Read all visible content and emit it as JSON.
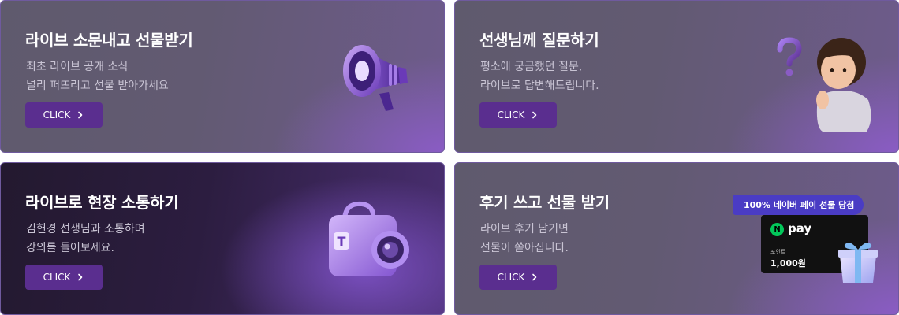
{
  "cards": [
    {
      "title": "라이브 소문내고 선물받기",
      "desc_line1": "최초 라이브 공개 소식",
      "desc_line2": "널리 퍼뜨리고 선물 받아가세요",
      "button_label": "CLICK",
      "illustration": "megaphone-icon"
    },
    {
      "title": "선생님께 질문하기",
      "desc_line1": "평소에 궁금했던 질문,",
      "desc_line2": "라이브로 답변해드립니다.",
      "button_label": "CLICK",
      "illustration": "thinking-person-question-mark"
    },
    {
      "title": "라이브로 현장 소통하기",
      "desc_line1": "김헌경 선생님과 소통하며",
      "desc_line2": "강의를 들어보세요.",
      "button_label": "CLICK",
      "illustration": "camera-bag-icon"
    },
    {
      "title": "후기 쓰고 선물 받기",
      "desc_line1": "라이브 후기 남기면",
      "desc_line2": "선물이 쏟아집니다.",
      "button_label": "CLICK",
      "illustration": "npay-giftcard-icon",
      "gift_banner": "100% 네이버 페이 선물 당첨",
      "npay_logo": "pay",
      "npay_n": "N",
      "point_label": "포인트",
      "point_amount": "1,000원"
    }
  ],
  "colors": {
    "button_bg": "#5a2e8f",
    "accent_purple": "#8a5cc4",
    "dark_card_bg": "#2c1d40"
  }
}
